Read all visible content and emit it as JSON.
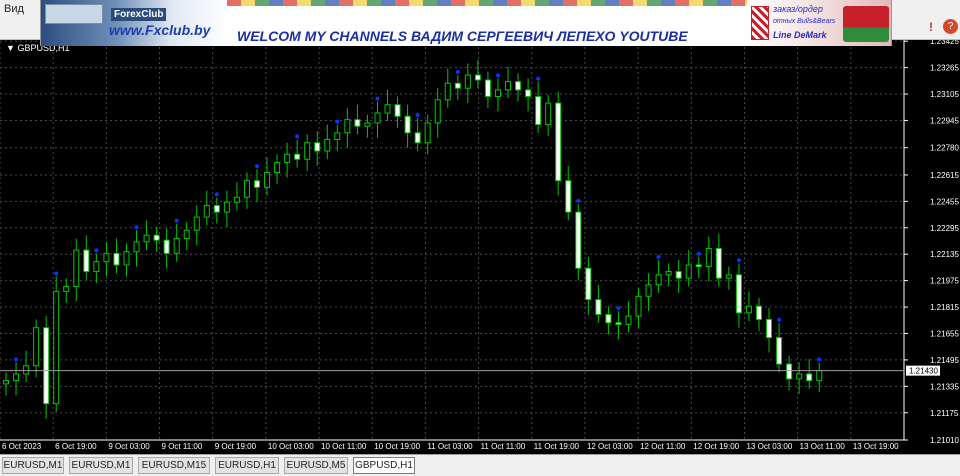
{
  "menu": {
    "view_label": "Вид"
  },
  "banner": {
    "club_name": "ForexClub",
    "url": "www.Fxclub.by",
    "headline": "WELCOM MY CHANNELS ВАДИМ СЕРГЕЕВИЧ ЛЕПЕХО YOUTUBE",
    "order_label": "заказ/ордер",
    "bulls_bears_label": "отных Bulls&Bears",
    "demark_label": "Line DeMark"
  },
  "toolbar": {
    "alert_icon": "exclamation-icon",
    "help_icon": "question-icon",
    "help_glyph": "?"
  },
  "chart_window": {
    "symbol": "GBPUSD,H1",
    "symbol_icon": "triangle-down-icon",
    "current_price": "1.21430",
    "colors": {
      "background": "#000000",
      "grid": "#4a4a4a",
      "candle": "#00c800",
      "candle_fill_bull": "#000000",
      "candle_fill_bear": "#ffffff",
      "marker": "#1030ff",
      "axis_text": "#ffffff",
      "price_line": "#a0a0a0"
    }
  },
  "chart_data": {
    "type": "candlestick",
    "ylim": [
      1.2101,
      1.2342
    ],
    "price_ticks": [
      "1.23425",
      "1.23265",
      "1.23105",
      "1.22945",
      "1.22780",
      "1.22615",
      "1.22455",
      "1.22295",
      "1.22135",
      "1.21975",
      "1.21815",
      "1.21655",
      "1.21495",
      "1.21335",
      "1.21175",
      "1.21010"
    ],
    "time_ticks": [
      "6 Oct 2023",
      "6 Oct 19:00",
      "9 Oct 03:00",
      "9 Oct 11:00",
      "9 Oct 19:00",
      "10 Oct 03:00",
      "10 Oct 11:00",
      "10 Oct 19:00",
      "11 Oct 03:00",
      "11 Oct 11:00",
      "11 Oct 19:00",
      "12 Oct 03:00",
      "12 Oct 11:00",
      "12 Oct 19:00",
      "13 Oct 03:00",
      "13 Oct 11:00",
      "13 Oct 19:00"
    ],
    "closes": [
      1.2137,
      1.2141,
      1.2146,
      1.2169,
      1.2123,
      1.2191,
      1.2194,
      1.2216,
      1.2203,
      1.2209,
      1.2214,
      1.2207,
      1.2215,
      1.2221,
      1.2225,
      1.2222,
      1.2214,
      1.2223,
      1.2228,
      1.2236,
      1.2243,
      1.2239,
      1.2245,
      1.2248,
      1.2258,
      1.2254,
      1.2263,
      1.2269,
      1.2274,
      1.2271,
      1.2281,
      1.2276,
      1.2283,
      1.2287,
      1.2295,
      1.2291,
      1.2293,
      1.2299,
      1.2304,
      1.2297,
      1.2287,
      1.2281,
      1.2293,
      1.2307,
      1.2317,
      1.2314,
      1.2322,
      1.2319,
      1.2309,
      1.2313,
      1.2318,
      1.2313,
      1.2309,
      1.2292,
      1.2305,
      1.2258,
      1.2239,
      1.2205,
      1.2186,
      1.2177,
      1.2172,
      1.2171,
      1.2176,
      1.2188,
      1.2195,
      1.2201,
      1.2203,
      1.2199,
      1.2207,
      1.2206,
      1.2217,
      1.2199,
      1.2201,
      1.2178,
      1.2182,
      1.2174,
      1.2163,
      1.2147,
      1.2138,
      1.2141,
      1.2137,
      1.2143
    ],
    "candles_count": 82
  },
  "tabs": [
    "EURUSD,M1",
    "EURUSD,M1",
    "EURUSD,M15",
    "EURUSD,H1",
    "EURUSD,M5",
    "GBPUSD,H1"
  ],
  "active_tab": "GBPUSD,H1"
}
